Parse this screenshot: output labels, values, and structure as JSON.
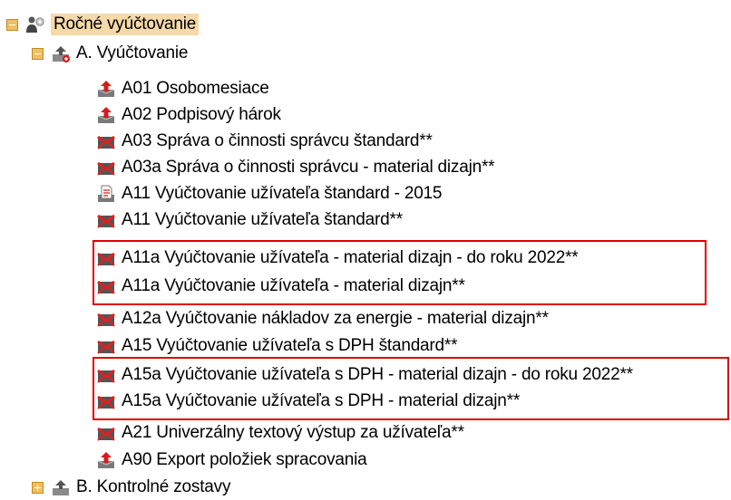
{
  "tree": {
    "root": {
      "label": "Ročné vyúčtovanie",
      "icon": "users-gear-icon"
    },
    "groups": [
      {
        "label": "A. Vyúčtovanie",
        "expanded": true,
        "items": [
          {
            "label": "A01 Osobomesiace",
            "icon": "export-arrow-icon"
          },
          {
            "label": "A02 Podpisový hárok",
            "icon": "export-arrow-icon"
          },
          {
            "label": "A03 Správa o činnosti správcu štandard**",
            "icon": "envelope-report-icon"
          },
          {
            "label": "A03a Správa o činnosti správcu - material dizajn**",
            "icon": "envelope-report-icon"
          },
          {
            "label": "A11 Vyúčtovanie užívateľa štandard - 2015",
            "icon": "document-report-icon"
          },
          {
            "label": "A11 Vyúčtovanie užívateľa štandard**",
            "icon": "envelope-report-icon"
          },
          {
            "label": "A11a Vyúčtovanie užívateľa - material dizajn  - do roku 2022**",
            "icon": "envelope-report-icon"
          },
          {
            "label": "A11a Vyúčtovanie užívateľa - material dizajn**",
            "icon": "envelope-report-icon"
          },
          {
            "label": "A12a Vyúčtovanie nákladov za energie - material dizajn**",
            "icon": "envelope-report-icon"
          },
          {
            "label": "A15 Vyúčtovanie užívateľa s DPH štandard**",
            "icon": "envelope-report-icon"
          },
          {
            "label": "A15a Vyúčtovanie užívateľa s DPH - material dizajn - do roku 2022**",
            "icon": "envelope-report-icon"
          },
          {
            "label": "A15a Vyúčtovanie užívateľa s DPH - material dizajn**",
            "icon": "envelope-report-icon"
          },
          {
            "label": "A21 Univerzálny textový výstup za užívateľa**",
            "icon": "envelope-report-icon"
          },
          {
            "label": "A90 Export položiek spracovania",
            "icon": "export-arrow-icon"
          }
        ]
      },
      {
        "label": "B. Kontrolné zostavy",
        "expanded": false
      }
    ]
  },
  "colors": {
    "highlight_box": "#e00000",
    "selection": "#f5d9a8",
    "expander": "#f0c060"
  }
}
